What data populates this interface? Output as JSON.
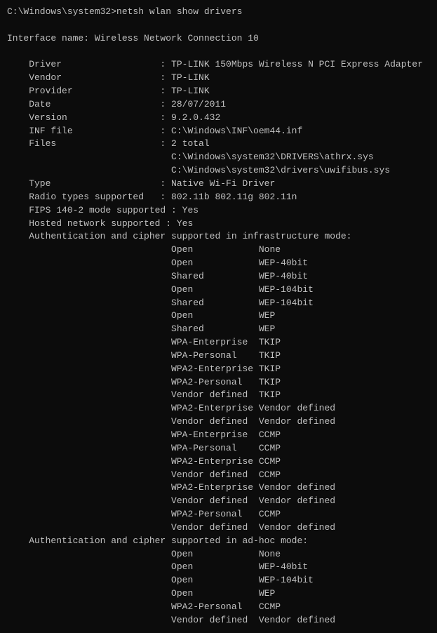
{
  "terminal": {
    "lines": [
      "C:\\Windows\\system32>netsh wlan show drivers",
      "",
      "Interface name: Wireless Network Connection 10",
      "",
      "    Driver                  : TP-LINK 150Mbps Wireless N PCI Express Adapter",
      "    Vendor                  : TP-LINK",
      "    Provider                : TP-LINK",
      "    Date                    : 28/07/2011",
      "    Version                 : 9.2.0.432",
      "    INF file                : C:\\Windows\\INF\\oem44.inf",
      "    Files                   : 2 total",
      "                              C:\\Windows\\system32\\DRIVERS\\athrx.sys",
      "                              C:\\Windows\\system32\\drivers\\uwifibus.sys",
      "    Type                    : Native Wi-Fi Driver",
      "    Radio types supported   : 802.11b 802.11g 802.11n",
      "    FIPS 140-2 mode supported : Yes",
      "    Hosted network supported : Yes",
      "    Authentication and cipher supported in infrastructure mode:",
      "                              Open            None",
      "                              Open            WEP-40bit",
      "                              Shared          WEP-40bit",
      "                              Open            WEP-104bit",
      "                              Shared          WEP-104bit",
      "                              Open            WEP",
      "                              Shared          WEP",
      "                              WPA-Enterprise  TKIP",
      "                              WPA-Personal    TKIP",
      "                              WPA2-Enterprise TKIP",
      "                              WPA2-Personal   TKIP",
      "                              Vendor defined  TKIP",
      "                              WPA2-Enterprise Vendor defined",
      "                              Vendor defined  Vendor defined",
      "                              WPA-Enterprise  CCMP",
      "                              WPA-Personal    CCMP",
      "                              WPA2-Enterprise CCMP",
      "                              Vendor defined  CCMP",
      "                              WPA2-Enterprise Vendor defined",
      "                              Vendor defined  Vendor defined",
      "                              WPA2-Personal   CCMP",
      "                              Vendor defined  Vendor defined",
      "    Authentication and cipher supported in ad-hoc mode:",
      "                              Open            None",
      "                              Open            WEP-40bit",
      "                              Open            WEP-104bit",
      "                              Open            WEP",
      "                              WPA2-Personal   CCMP",
      "                              Vendor defined  Vendor defined"
    ]
  }
}
